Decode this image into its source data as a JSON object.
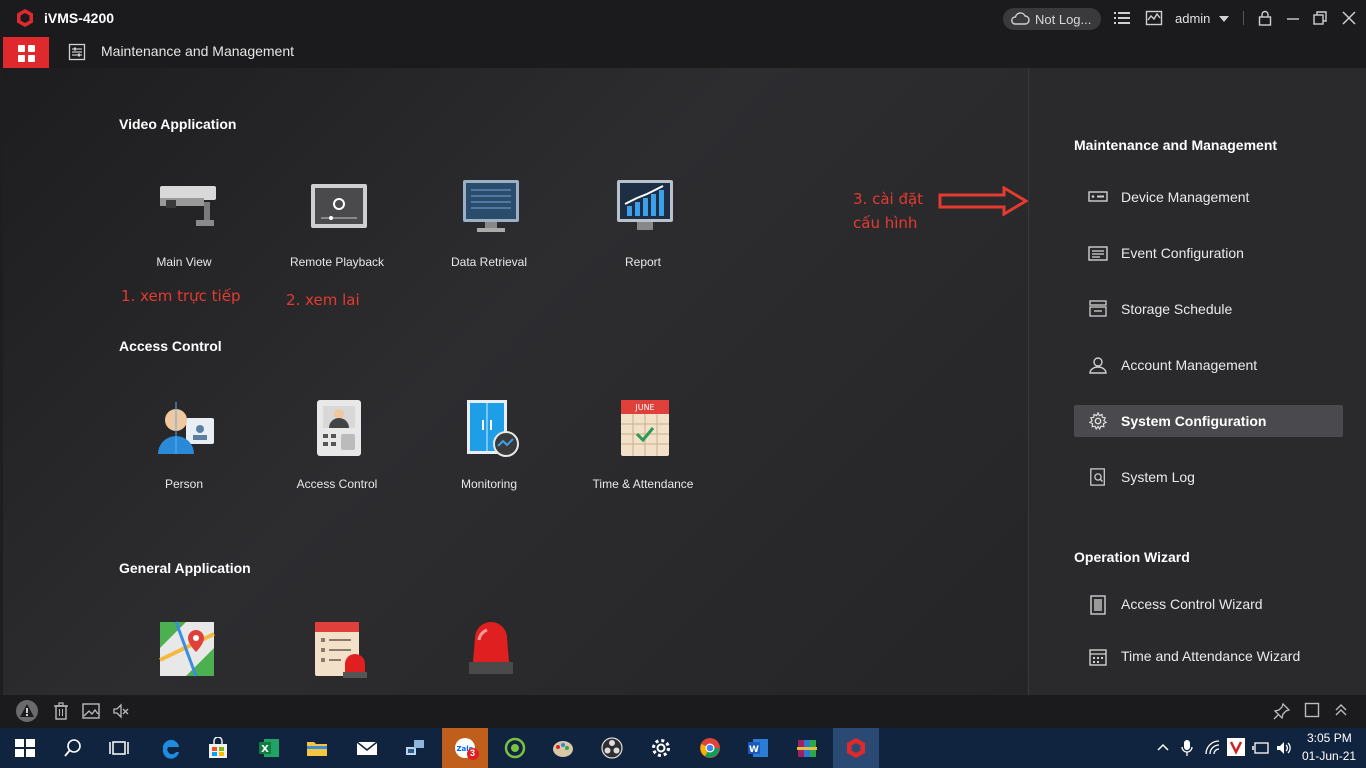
{
  "titlebar": {
    "app_title": "iVMS-4200",
    "cloud_status": "Not Log...",
    "user": "admin"
  },
  "navbar": {
    "page_title": "Maintenance and Management"
  },
  "main": {
    "sections": [
      {
        "title": "Video Application",
        "tiles": [
          {
            "label": "Main View",
            "icon": "cctv-camera-icon"
          },
          {
            "label": "Remote Playback",
            "icon": "playback-icon"
          },
          {
            "label": "Data Retrieval",
            "icon": "monitor-search-icon"
          },
          {
            "label": "Report",
            "icon": "chart-report-icon"
          }
        ]
      },
      {
        "title": "Access Control",
        "tiles": [
          {
            "label": "Person",
            "icon": "person-card-icon"
          },
          {
            "label": "Access Control",
            "icon": "door-terminal-icon"
          },
          {
            "label": "Monitoring",
            "icon": "door-monitor-icon"
          },
          {
            "label": "Time & Attendance",
            "icon": "calendar-check-icon"
          }
        ]
      },
      {
        "title": "General Application",
        "tiles": [
          {
            "label": "",
            "icon": "map-pin-icon"
          },
          {
            "label": "",
            "icon": "event-alarm-icon"
          },
          {
            "label": "",
            "icon": "siren-icon"
          }
        ]
      }
    ],
    "annotations": {
      "a1": "1. xem trực tiếp",
      "a2": "2. xem lai",
      "a3_line1": "3. cài đặt",
      "a3_line2": "cấu hình"
    }
  },
  "right_panel": {
    "heading": "Maintenance and Management",
    "items": [
      {
        "label": "Device Management",
        "icon": "device-icon"
      },
      {
        "label": "Event Configuration",
        "icon": "event-config-icon"
      },
      {
        "label": "Storage Schedule",
        "icon": "storage-icon"
      },
      {
        "label": "Account Management",
        "icon": "user-icon"
      },
      {
        "label": "System Configuration",
        "icon": "gear-icon",
        "active": true
      },
      {
        "label": "System Log",
        "icon": "log-search-icon"
      }
    ],
    "wizard_heading": "Operation Wizard",
    "wizards": [
      {
        "label": "Access Control Wizard",
        "icon": "door-icon"
      },
      {
        "label": "Time and Attendance Wizard",
        "icon": "calendar-icon"
      }
    ]
  },
  "taskbar": {
    "zalo_badge": "3",
    "time": "3:05 PM",
    "date": "01-Jun-21"
  },
  "colors": {
    "accent": "#e0292d",
    "annotation": "#e43a2f",
    "taskbar": "#10243f"
  }
}
